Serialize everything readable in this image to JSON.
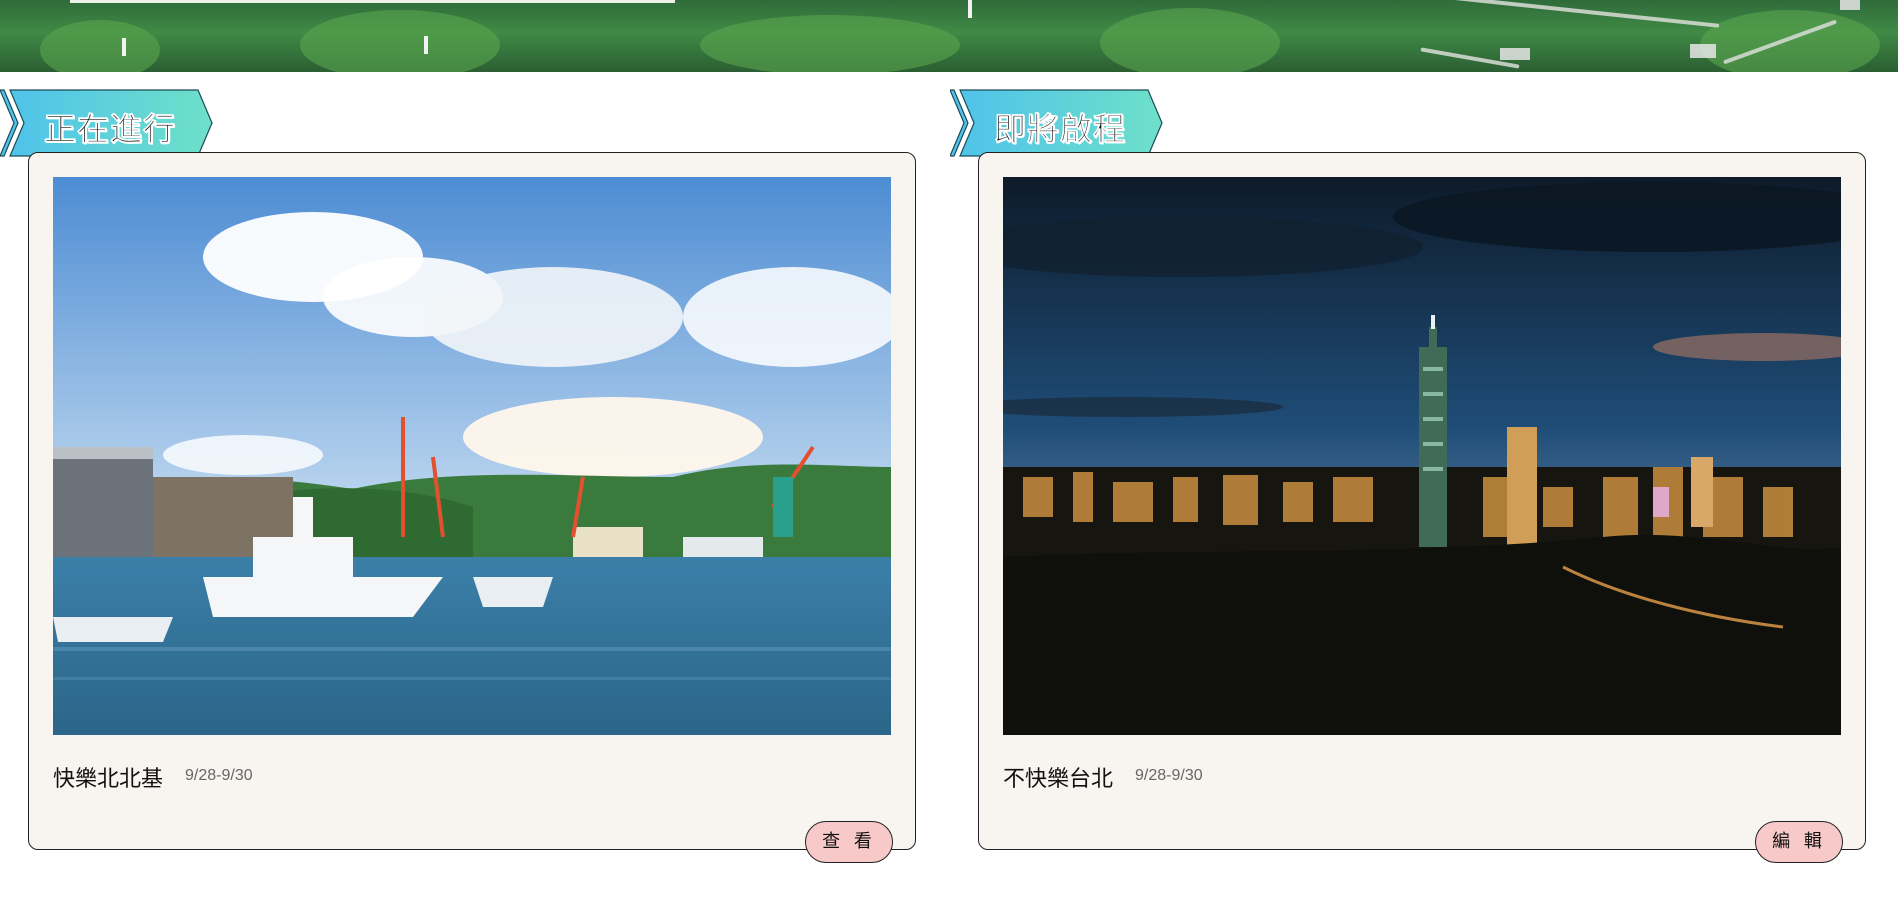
{
  "hero": {
    "description": "",
    "accent": "#3f8a45"
  },
  "sections": [
    {
      "heading": "正在進行",
      "ribbon_color_start": "#4fc3ea",
      "ribbon_color_end": "#6ee0c9",
      "card": {
        "title": "快樂北北基",
        "date": "9/28-9/30",
        "button_label": "查 看",
        "image_icon": "harbor-photo"
      }
    },
    {
      "heading": "即將啟程",
      "ribbon_color_start": "#4fc3ea",
      "ribbon_color_end": "#6ee0c9",
      "card": {
        "title": "不快樂台北",
        "date": "9/28-9/30",
        "button_label": "編 輯",
        "image_icon": "city-night-photo"
      }
    }
  ],
  "colors": {
    "card_bg": "#f8f5f1",
    "button_bg": "#f8c9c9",
    "border": "#222222"
  }
}
